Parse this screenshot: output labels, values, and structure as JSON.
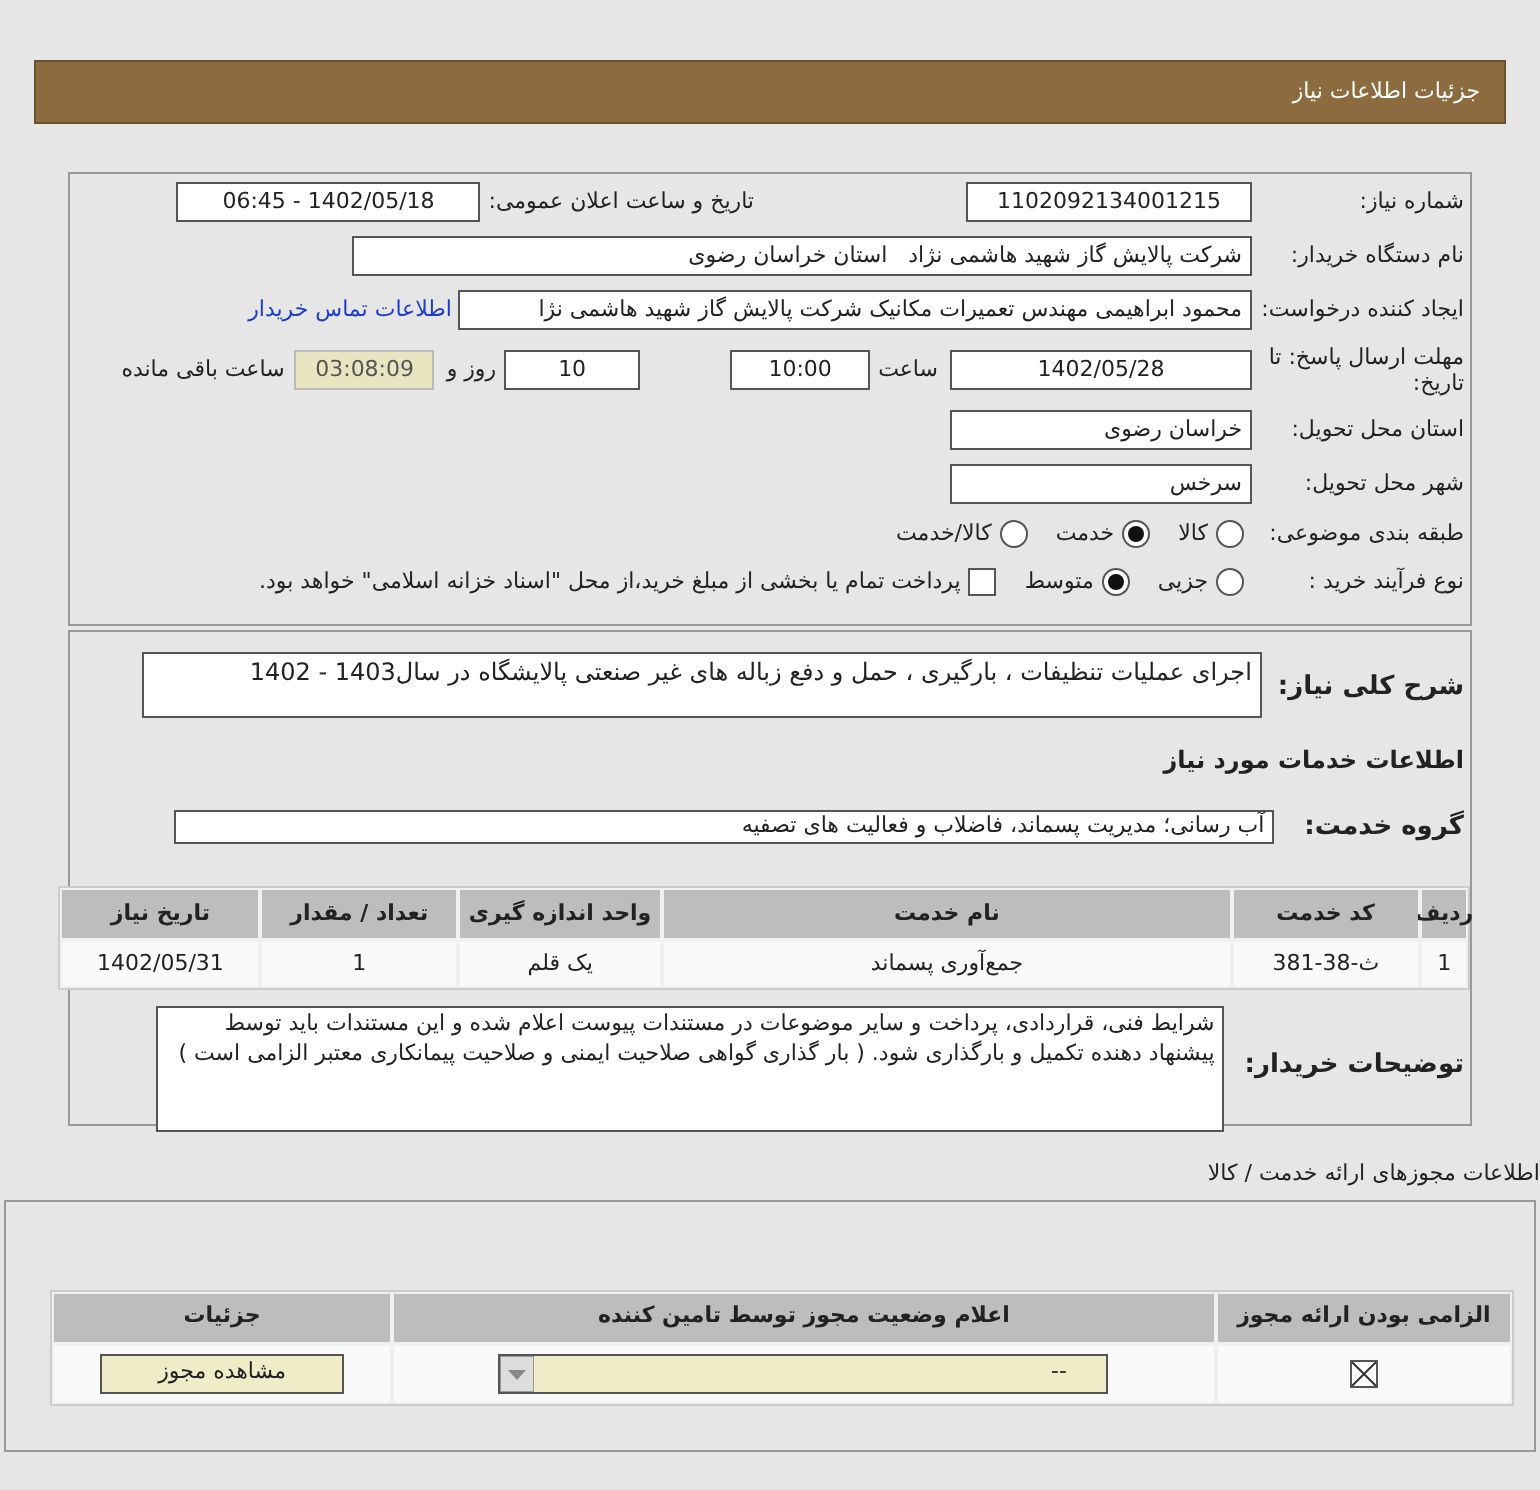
{
  "header": {
    "title": "جزئیات اطلاعات نیاز"
  },
  "details": {
    "need_number": {
      "label": "شماره نیاز:",
      "value": "1102092134001215"
    },
    "announce": {
      "label": "تاریخ و ساعت اعلان عمومی:",
      "value": "1402/05/18 - 06:45"
    },
    "buyer": {
      "label": "نام دستگاه خریدار:",
      "value": "شرکت پالایش گاز شهید هاشمی نژاد   استان خراسان رضوی"
    },
    "requester": {
      "label": "ایجاد کننده درخواست:",
      "value": "محمود ابراهیمی مهندس تعمیرات مکانیک شرکت پالایش گاز شهید هاشمی نژا",
      "link": "اطلاعات تماس خریدار"
    },
    "deadline": {
      "label": "مهلت ارسال پاسخ: تا تاریخ:",
      "date": "1402/05/28",
      "time_label": "ساعت",
      "time": "10:00",
      "days": "10",
      "days_label": "روز و",
      "remaining": "03:08:09",
      "remaining_label": "ساعت باقی مانده"
    },
    "province": {
      "label": "استان محل تحویل:",
      "value": "خراسان رضوی"
    },
    "city": {
      "label": "شهر محل تحویل:",
      "value": "سرخس"
    },
    "category": {
      "label": "طبقه بندی موضوعی:",
      "options": [
        {
          "label": "کالا",
          "selected": false
        },
        {
          "label": "خدمت",
          "selected": true
        },
        {
          "label": "کالا/خدمت",
          "selected": false
        }
      ]
    },
    "process": {
      "label": "نوع فرآیند خرید :",
      "options": [
        {
          "label": "جزیی",
          "selected": false
        },
        {
          "label": "متوسط",
          "selected": true
        }
      ],
      "checkbox": {
        "label": "پرداخت تمام یا بخشی از مبلغ خرید،از محل \"اسناد خزانه اسلامی\" خواهد بود.",
        "checked": false
      }
    }
  },
  "need": {
    "description_label": "شرح کلی نیاز:",
    "description": "اجرای عملیات تنظیفات ، بارگیری ، حمل و دفع زباله های غیر صنعتی پالایشگاه در سال1403 - 1402",
    "services_heading": "اطلاعات خدمات مورد نیاز",
    "group_label": "گروه خدمت:",
    "group": "آب رسانی؛ مدیریت پسماند، فاضلاب و فعالیت های تصفیه",
    "table": {
      "columns": [
        "ردیف",
        "کد خدمت",
        "نام خدمت",
        "واحد اندازه گیری",
        "تعداد / مقدار",
        "تاریخ نیاز"
      ],
      "rows": [
        [
          "1",
          "ث-38-381",
          "جمع‌آوری پسماند",
          "یک قلم",
          "1",
          "1402/05/31"
        ]
      ]
    },
    "notes_label": "توضیحات خریدار:",
    "notes": "شرایط فنی، قراردادی، پرداخت و سایر موضوعات در مستندات پیوست اعلام شده و این مستندات باید توسط پیشنهاد دهنده تکمیل و  بارگذاری شود. ( بار گذاری گواهی صلاحیت ایمنی و صلاحیت پیمانکاری معتبر الزامی است )"
  },
  "permits": {
    "title": "اطلاعات مجوزهای ارائه خدمت / کالا",
    "columns": [
      "الزامی بودن ارائه مجوز",
      "اعلام وضعیت مجوز توسط تامین کننده",
      "جزئیات"
    ],
    "rows": [
      {
        "required": true,
        "status": "--",
        "button": "مشاهده مجوز"
      }
    ]
  }
}
